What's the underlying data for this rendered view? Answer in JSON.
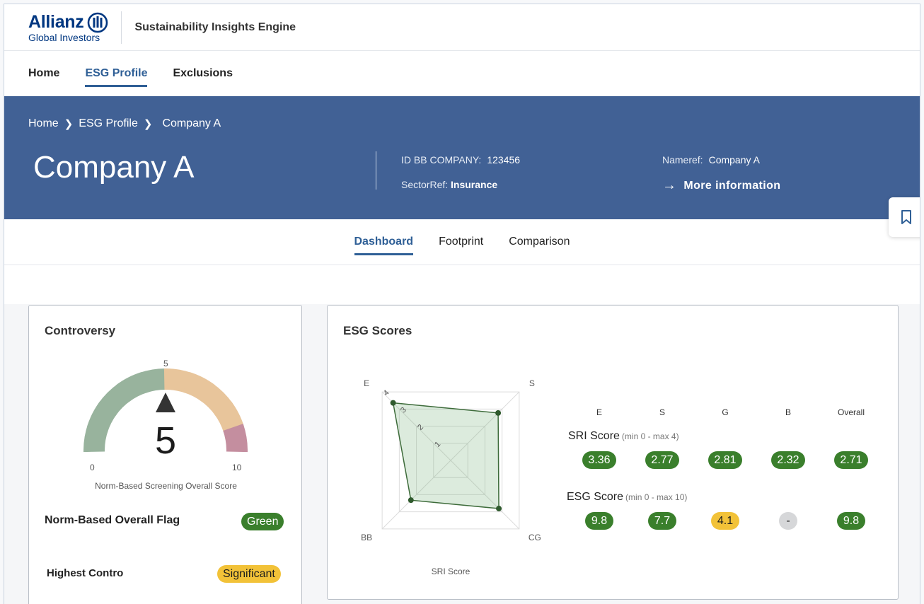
{
  "header": {
    "brand": "Allianz",
    "brand_sub": "Global Investors",
    "app_title": "Sustainability Insights Engine"
  },
  "nav": {
    "items": [
      {
        "label": "Home",
        "active": false
      },
      {
        "label": "ESG Profile",
        "active": true
      },
      {
        "label": "Exclusions",
        "active": false
      }
    ]
  },
  "banner": {
    "breadcrumb": [
      "Home",
      "ESG Profile",
      "Company A"
    ],
    "company_name": "Company A",
    "id_label": "ID BB COMPANY:",
    "id_value": "123456",
    "sector_label": "SectorRef:",
    "sector_value": "Insurance",
    "nameref_label": "Nameref:",
    "nameref_value": "Company A",
    "more_info": "More information"
  },
  "subtabs": [
    {
      "label": "Dashboard",
      "active": true
    },
    {
      "label": "Footprint",
      "active": false
    },
    {
      "label": "Comparison",
      "active": false
    }
  ],
  "controversy": {
    "title": "Controversy",
    "gauge": {
      "value": 5,
      "value_label": "5",
      "min": "0",
      "max": "10",
      "mid": "5",
      "caption": "Norm-Based Screening Overall Score"
    },
    "flag_label": "Norm-Based Overall Flag",
    "flag_value": "Green",
    "highest_label": "Highest Contro",
    "highest_value": "Significant",
    "colors": {
      "green": "#98b39d",
      "orange": "#e8c59b",
      "pink": "#c48e9f"
    }
  },
  "esg": {
    "title": "ESG Scores",
    "radar": {
      "axes": [
        "E",
        "S",
        "CG",
        "BB"
      ],
      "ring_labels": [
        "1",
        "2",
        "3",
        "4"
      ],
      "caption": "SRI Score",
      "values": [
        3.36,
        2.77,
        2.81,
        2.32
      ],
      "max": 4
    },
    "columns": [
      "E",
      "S",
      "G",
      "B",
      "Overall"
    ],
    "sri_title": "SRI Score",
    "sri_sub": "(min 0 - max 4)",
    "sri_values": [
      "3.36",
      "2.77",
      "2.81",
      "2.32",
      "2.71"
    ],
    "esg_title": "ESG Score",
    "esg_sub": "(min 0 - max 10)",
    "esg_values": [
      "9.8",
      "7.7",
      "4.1",
      "-",
      "9.8"
    ]
  }
}
